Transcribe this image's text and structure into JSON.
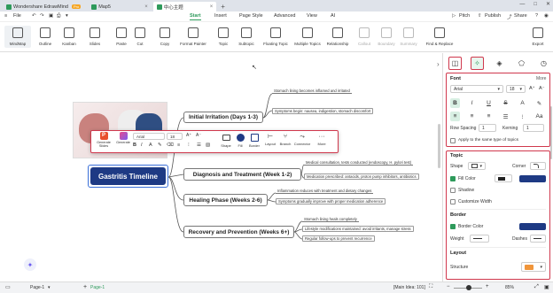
{
  "titlebar": {
    "tabs": [
      {
        "label": "Wondershare EdrawMind",
        "badge": "Pro"
      },
      {
        "label": "Map5"
      },
      {
        "label": "中心主题"
      }
    ],
    "window_controls": [
      "—",
      "□",
      "✕"
    ]
  },
  "menubar": {
    "file": "File",
    "tabs": [
      "Start",
      "Insert",
      "Page Style",
      "Advanced",
      "View",
      "AI"
    ],
    "right": [
      "Pitch",
      "Publish",
      "Share"
    ]
  },
  "ribbon": {
    "buttons": [
      {
        "label": "MindMap"
      },
      {
        "label": "Outline"
      },
      {
        "label": "Kanban"
      },
      {
        "label": "Slides"
      },
      {
        "label": "Paste"
      },
      {
        "label": "Cut"
      },
      {
        "label": "Copy"
      },
      {
        "label": "Format Painter"
      },
      {
        "label": "Topic"
      },
      {
        "label": "Subtopic"
      },
      {
        "label": "Floating Topic"
      },
      {
        "label": "Multiple Topics"
      },
      {
        "label": "Relationship"
      },
      {
        "label": "Callout"
      },
      {
        "label": "Boundary"
      },
      {
        "label": "Summary"
      },
      {
        "label": "Find & Replace"
      },
      {
        "label": "Export"
      }
    ]
  },
  "mindmap": {
    "central": "Gastritis Timeline",
    "branches": [
      {
        "title": "Initial Irritation (Days 1-3)",
        "leaves": [
          "Stomach lining becomes inflamed and irritated",
          "Symptoms begin: nausea, indigestion, stomach discomfort"
        ]
      },
      {
        "title": "Diagnosis and Treatment (Week 1-2)",
        "leaves": [
          "Medical consultation, tests conducted (endoscopy, H. pylori test)",
          "Medication prescribed: antacids, proton pump inhibitors, antibiotics"
        ]
      },
      {
        "title": "Healing Phase (Weeks 2-6)",
        "leaves": [
          "Inflammation reduces with treatment and dietary changes",
          "Symptoms gradually improve with proper medication adherence"
        ]
      },
      {
        "title": "Recovery and Prevention (Weeks 6+)",
        "leaves": [
          "Stomach lining heals completely",
          "Lifestyle modifications maintained: avoid irritants, manage stress",
          "Regular follow-ups to prevent recurrence"
        ]
      }
    ],
    "hidden_leaf_fragments": [
      "per abdomen",
      "chol"
    ]
  },
  "float_toolbar": {
    "font": "Arial",
    "size": "18",
    "buttons": [
      "Generate Slides",
      "Generate",
      "Shape",
      "Fill",
      "Border",
      "Layout",
      "Branch",
      "Connector",
      "More"
    ]
  },
  "panel": {
    "font": {
      "title": "Font",
      "more": "More",
      "family": "Arial",
      "size": "18",
      "row_spacing_label": "Row Spacing",
      "row_spacing": "1",
      "kerning_label": "Kerning",
      "kerning": "1",
      "apply_label": "Apply to the same type of topics"
    },
    "topic": {
      "title": "Topic",
      "shape_label": "Shape",
      "corner_label": "Corner",
      "fill_label": "Fill Color",
      "shadow_label": "Shadow",
      "custom_width_label": "Customize Width"
    },
    "border": {
      "title": "Border",
      "color_label": "Border Color",
      "weight_label": "Weight",
      "dashes_label": "Dashes"
    },
    "layout": {
      "title": "Layout",
      "structure_label": "Structure"
    },
    "colors": {
      "fill": "#1e3a84",
      "border": "#1e3a84",
      "accent": "#2e9a5b",
      "highlight": "#d0384d"
    }
  },
  "status": {
    "page_tab": "Page-1",
    "page_tab_active": "Page-1",
    "main_idea": "[Main Idea: 101]",
    "zoom": "85%"
  }
}
